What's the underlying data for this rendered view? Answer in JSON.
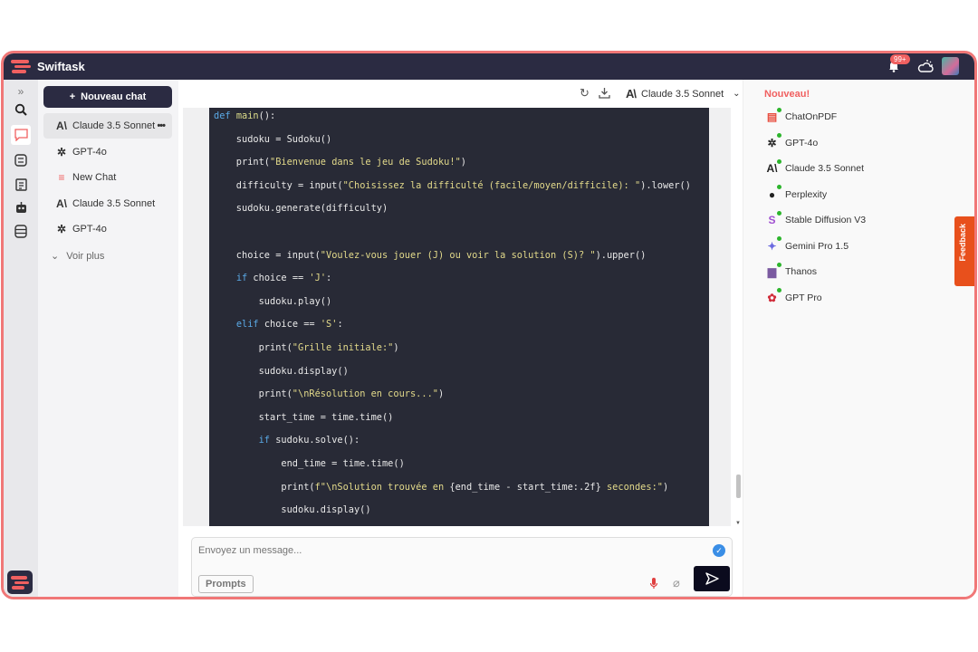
{
  "app": {
    "title": "Swiftask",
    "notification_count": "99+",
    "accent": "#f06060",
    "dark": "#2b2b42"
  },
  "sidebar": {
    "new_chat_label": "Nouveau chat",
    "history": [
      {
        "label": "Claude 3.5 Sonnet",
        "icon": "anthropic-icon",
        "active": true
      },
      {
        "label": "GPT-4o",
        "icon": "openai-icon"
      },
      {
        "label": "New Chat",
        "icon": "swiftask-icon"
      },
      {
        "label": "Claude 3.5 Sonnet",
        "icon": "anthropic-icon"
      },
      {
        "label": "GPT-4o",
        "icon": "openai-icon"
      }
    ],
    "more_label": "Voir plus"
  },
  "toolbar": {
    "model": "Claude 3.5 Sonnet"
  },
  "code": [
    [
      [
        "def ",
        "kw"
      ],
      [
        "main",
        "fn"
      ],
      [
        "():",
        ""
      ]
    ],
    [
      [
        "    sudoku = Sudoku()",
        ""
      ]
    ],
    [
      [
        "    print(",
        ""
      ],
      [
        "\"Bienvenue dans le jeu de Sudoku!\"",
        "st"
      ],
      [
        ")",
        ""
      ]
    ],
    [
      [
        "    difficulty = input(",
        ""
      ],
      [
        "\"Choisissez la difficulté (facile/moyen/difficile): \"",
        "st"
      ],
      [
        ").lower()",
        ""
      ]
    ],
    [
      [
        "    sudoku.generate(difficulty)",
        ""
      ]
    ],
    [
      [
        "",
        ""
      ]
    ],
    [
      [
        "    choice = input(",
        ""
      ],
      [
        "\"Voulez-vous jouer (J) ou voir la solution (S)? \"",
        "st"
      ],
      [
        ").upper()",
        ""
      ]
    ],
    [
      [
        "    ",
        ""
      ],
      [
        "if",
        "kw"
      ],
      [
        " choice == ",
        ""
      ],
      [
        "'J'",
        "st"
      ],
      [
        ":",
        ""
      ]
    ],
    [
      [
        "        sudoku.play()",
        ""
      ]
    ],
    [
      [
        "    ",
        ""
      ],
      [
        "elif",
        "kw"
      ],
      [
        " choice == ",
        ""
      ],
      [
        "'S'",
        "st"
      ],
      [
        ":",
        ""
      ]
    ],
    [
      [
        "        print(",
        ""
      ],
      [
        "\"Grille initiale:\"",
        "st"
      ],
      [
        ")",
        ""
      ]
    ],
    [
      [
        "        sudoku.display()",
        ""
      ]
    ],
    [
      [
        "        print(",
        ""
      ],
      [
        "\"\\nRésolution en cours...\"",
        "st"
      ],
      [
        ")",
        ""
      ]
    ],
    [
      [
        "        start_time = time.time()",
        ""
      ]
    ],
    [
      [
        "        ",
        ""
      ],
      [
        "if",
        "kw"
      ],
      [
        " sudoku.solve():",
        ""
      ]
    ],
    [
      [
        "            end_time = time.time()",
        ""
      ]
    ],
    [
      [
        "            print(",
        ""
      ],
      [
        "f\"\\nSolution trouvée en ",
        "st"
      ],
      [
        "{end_time - start_time:.2f}",
        ""
      ],
      [
        " secondes:\"",
        "st"
      ],
      [
        ")",
        ""
      ]
    ],
    [
      [
        "            sudoku.display()",
        ""
      ]
    ]
  ],
  "composer": {
    "placeholder": "Envoyez un message...",
    "prompts_label": "Prompts"
  },
  "right_panel": {
    "title": "Nouveau!",
    "apps": [
      {
        "label": "ChatOnPDF",
        "icon": "pdf-icon",
        "color": "#e84c3d"
      },
      {
        "label": "GPT-4o",
        "icon": "openai-icon",
        "color": "#222222"
      },
      {
        "label": "Claude 3.5 Sonnet",
        "icon": "anthropic-icon",
        "color": "#222222"
      },
      {
        "label": "Perplexity",
        "icon": "perplexity-icon",
        "color": "#222222"
      },
      {
        "label": "Stable Diffusion V3",
        "icon": "stable-diffusion-icon",
        "color": "#a050d0"
      },
      {
        "label": "Gemini Pro 1.5",
        "icon": "gemini-icon",
        "color": "#6b6be0"
      },
      {
        "label": "Thanos",
        "icon": "thanos-icon",
        "color": "#7a5aa0"
      },
      {
        "label": "GPT Pro",
        "icon": "gpt-pro-icon",
        "color": "#d02c3a"
      }
    ],
    "feedback_label": "Feedback"
  }
}
